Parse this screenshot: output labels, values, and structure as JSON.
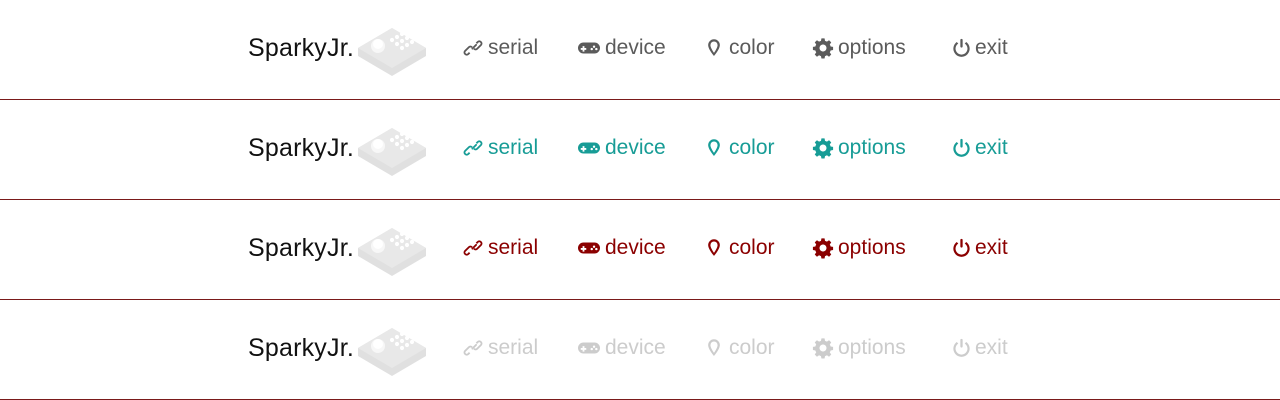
{
  "brand": "SparkyJr.",
  "nav": {
    "serial": {
      "label": "serial",
      "icon": "link-icon"
    },
    "device": {
      "label": "device",
      "icon": "gamepad-icon"
    },
    "color": {
      "label": "color",
      "icon": "map-pin-icon"
    },
    "options": {
      "label": "options",
      "icon": "gear-icon"
    },
    "exit": {
      "label": "exit",
      "icon": "power-icon"
    }
  },
  "variants": [
    {
      "state": "default",
      "color": "#5b5b5b"
    },
    {
      "state": "teal",
      "color": "#179c96"
    },
    {
      "state": "red",
      "color": "#8b0000"
    },
    {
      "state": "disabled",
      "color": "#cccccc"
    }
  ],
  "divider_color": "#7a1a1a",
  "logo_icon": "arcade-stick-icon"
}
